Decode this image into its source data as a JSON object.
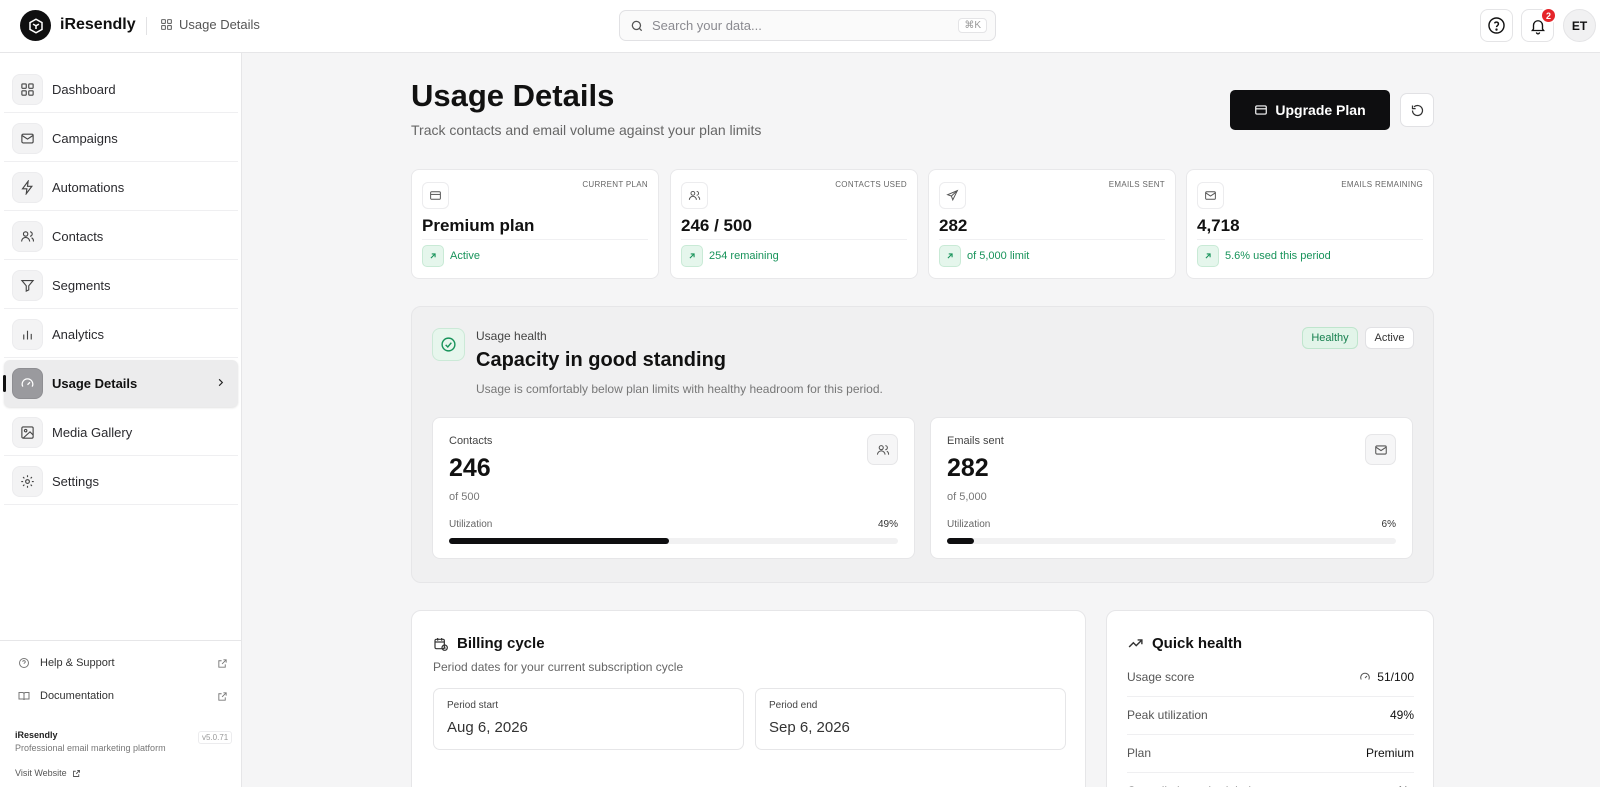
{
  "topbar": {
    "brand": "iResendly",
    "breadcrumb": "Usage Details",
    "search_placeholder": "Search your data...",
    "search_shortcut": "⌘K",
    "notification_count": "2",
    "avatar_initials": "ET"
  },
  "sidebar": {
    "items": [
      {
        "label": "Dashboard",
        "icon": "grid-icon"
      },
      {
        "label": "Campaigns",
        "icon": "mail-icon"
      },
      {
        "label": "Automations",
        "icon": "bolt-icon"
      },
      {
        "label": "Contacts",
        "icon": "users-icon"
      },
      {
        "label": "Segments",
        "icon": "filter-icon"
      },
      {
        "label": "Analytics",
        "icon": "bar-chart-icon"
      },
      {
        "label": "Usage Details",
        "icon": "gauge-icon",
        "active": true
      },
      {
        "label": "Media Gallery",
        "icon": "image-icon"
      },
      {
        "label": "Settings",
        "icon": "gear-icon"
      }
    ],
    "footer": {
      "help": "Help & Support",
      "docs": "Documentation",
      "app_name": "iResendly",
      "tagline": "Professional email marketing platform",
      "version": "v5.0.71",
      "visit": "Visit Website"
    }
  },
  "header": {
    "title": "Usage Details",
    "subtitle": "Track contacts and email volume against your plan limits",
    "upgrade_label": "Upgrade Plan"
  },
  "stats": [
    {
      "label": "CURRENT PLAN",
      "value": "Premium plan",
      "foot": "Active"
    },
    {
      "label": "CONTACTS USED",
      "value": "246 / 500",
      "foot": "254 remaining"
    },
    {
      "label": "EMAILS SENT",
      "value": "282",
      "foot": "of 5,000 limit"
    },
    {
      "label": "EMAILS REMAINING",
      "value": "4,718",
      "foot": "5.6% used this period"
    }
  ],
  "health": {
    "kicker": "Usage health",
    "title": "Capacity in good standing",
    "description": "Usage is comfortably below plan limits with healthy headroom for this period.",
    "badge_status": "Healthy",
    "badge_state": "Active",
    "utilization_label": "Utilization",
    "contacts": {
      "label": "Contacts",
      "value": "246",
      "of": "of 500",
      "pct_label": "49%",
      "pct": 49
    },
    "emails": {
      "label": "Emails sent",
      "value": "282",
      "of": "of 5,000",
      "pct_label": "6%",
      "pct": 6
    }
  },
  "billing": {
    "title": "Billing cycle",
    "subtitle": "Period dates for your current subscription cycle",
    "start_label": "Period start",
    "start_value": "Aug 6, 2026",
    "end_label": "Period end",
    "end_value": "Sep 6, 2026"
  },
  "quick": {
    "title": "Quick health",
    "rows": [
      {
        "key": "Usage score",
        "value": "51/100"
      },
      {
        "key": "Peak utilization",
        "value": "49%"
      },
      {
        "key": "Plan",
        "value": "Premium"
      },
      {
        "key": "Cancellation scheduled",
        "value": "No"
      }
    ]
  },
  "colors": {
    "accent": "#0e0e10",
    "success": "#17935a",
    "alert": "#e5252a"
  }
}
